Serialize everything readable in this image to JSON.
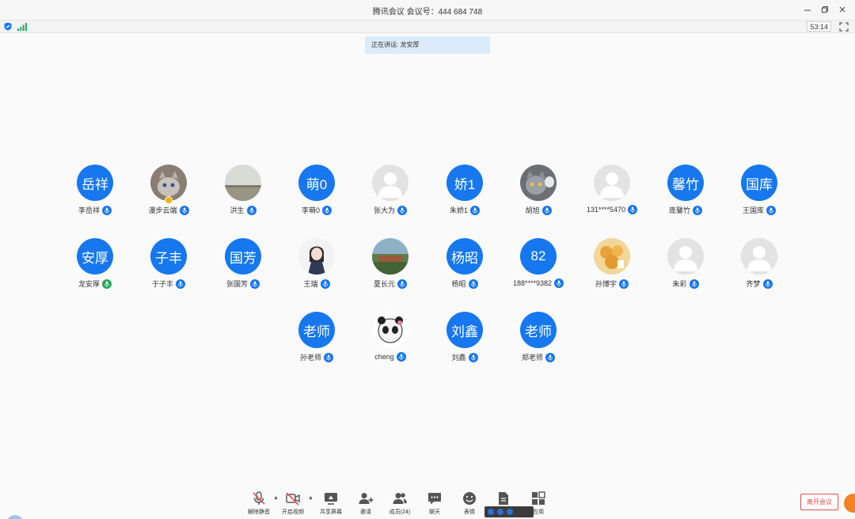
{
  "window": {
    "title": "腾讯会议 会议号：444 684 748",
    "controls": [
      "minimize-icon",
      "restore-icon",
      "close-icon"
    ]
  },
  "status": {
    "timer": "53:14",
    "icons": [
      "shield-icon",
      "signal-icon",
      "fullscreen-icon"
    ]
  },
  "speaking_banner": "正在讲话: 龙安厚",
  "participants": [
    {
      "name": "李岳祥",
      "avatar_text": "岳祥",
      "avatar": "text",
      "mic": "muted"
    },
    {
      "name": "漫步云端",
      "avatar_text": "",
      "avatar": "cat-photo",
      "mic": "muted",
      "host": true
    },
    {
      "name": "洪生",
      "avatar_text": "",
      "avatar": "landscape-photo",
      "mic": "muted"
    },
    {
      "name": "李萌0",
      "avatar_text": "萌0",
      "avatar": "text",
      "mic": "muted"
    },
    {
      "name": "张大为",
      "avatar_text": "",
      "avatar": "default",
      "mic": "muted"
    },
    {
      "name": "朱娇1",
      "avatar_text": "娇1",
      "avatar": "text",
      "mic": "muted"
    },
    {
      "name": "胡旭",
      "avatar_text": "",
      "avatar": "cat2-photo",
      "mic": "muted"
    },
    {
      "name": "131****5470",
      "avatar_text": "",
      "avatar": "default",
      "mic": "muted"
    },
    {
      "name": "庞馨竹",
      "avatar_text": "馨竹",
      "avatar": "text",
      "mic": "muted"
    },
    {
      "name": "王国库",
      "avatar_text": "国库",
      "avatar": "text",
      "mic": "muted"
    },
    {
      "name": "龙安厚",
      "avatar_text": "安厚",
      "avatar": "text",
      "mic": "speaking"
    },
    {
      "name": "于子丰",
      "avatar_text": "子丰",
      "avatar": "text",
      "mic": "muted"
    },
    {
      "name": "张国芳",
      "avatar_text": "国芳",
      "avatar": "text",
      "mic": "muted"
    },
    {
      "name": "王瑞",
      "avatar_text": "",
      "avatar": "anime-photo",
      "mic": "muted"
    },
    {
      "name": "夏长元",
      "avatar_text": "",
      "avatar": "town-photo",
      "mic": "muted"
    },
    {
      "name": "杨昭",
      "avatar_text": "杨昭",
      "avatar": "text",
      "mic": "muted"
    },
    {
      "name": "188****9382",
      "avatar_text": "82",
      "avatar": "text",
      "mic": "muted"
    },
    {
      "name": "孙博宇",
      "avatar_text": "",
      "avatar": "food-photo",
      "mic": "muted"
    },
    {
      "name": "朱彩",
      "avatar_text": "",
      "avatar": "default",
      "mic": "muted"
    },
    {
      "name": "齐梦",
      "avatar_text": "",
      "avatar": "default",
      "mic": "muted"
    },
    {
      "name": "孙老师",
      "avatar_text": "老师",
      "avatar": "text",
      "mic": "muted"
    },
    {
      "name": "cheng",
      "avatar_text": "",
      "avatar": "panda-photo",
      "mic": "muted"
    },
    {
      "name": "刘鑫",
      "avatar_text": "刘鑫",
      "avatar": "text",
      "mic": "muted"
    },
    {
      "name": "郑老师",
      "avatar_text": "老师",
      "avatar": "text",
      "mic": "muted"
    }
  ],
  "toolbar": {
    "unmute": "解除静音",
    "start_video": "开启视频",
    "share_screen": "共享屏幕",
    "invite": "邀请",
    "members": "成员(24)",
    "chat": "聊天",
    "reactions": "表情",
    "docs": "文档",
    "apps": "应用"
  },
  "leave_label": "离开会议",
  "colors": {
    "accent": "#1677ee",
    "speaking": "#22a85a",
    "leave": "#e34d4d",
    "banner": "#dcebfb"
  }
}
